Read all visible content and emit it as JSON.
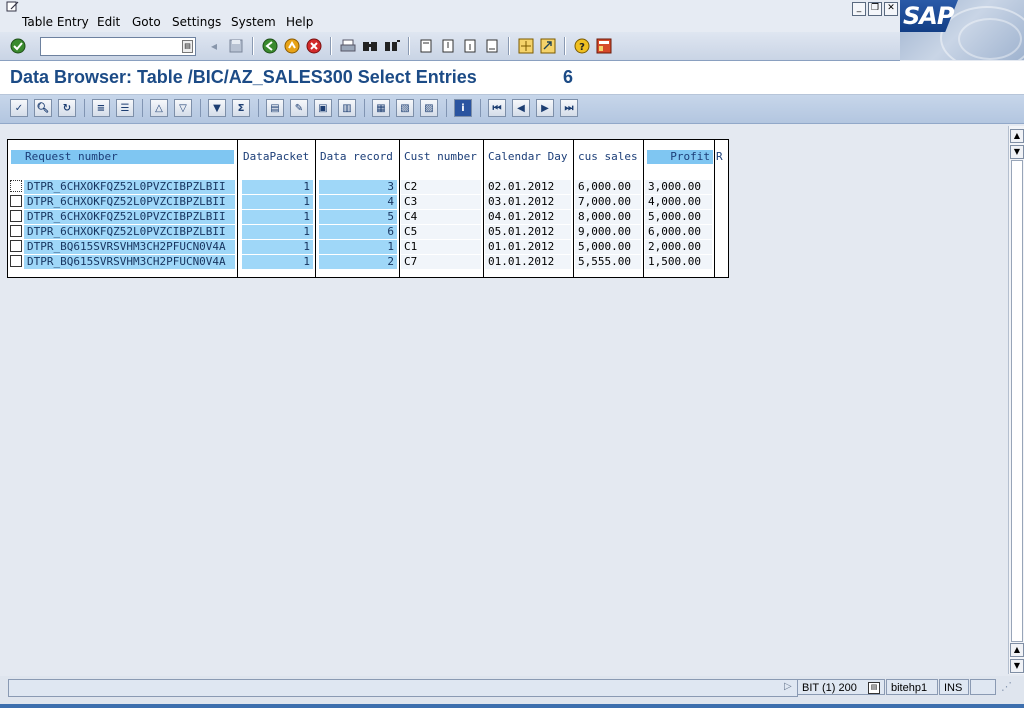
{
  "menu": {
    "items": [
      {
        "label": "Table Entry",
        "accel": "T"
      },
      {
        "label": "Edit",
        "accel": "E"
      },
      {
        "label": "Goto",
        "accel": "G"
      },
      {
        "label": "Settings",
        "accel": "S"
      },
      {
        "label": "System",
        "accel": "y"
      },
      {
        "label": "Help",
        "accel": "H"
      }
    ]
  },
  "brand": {
    "logo_text": "SAP"
  },
  "command_field": {
    "value": ""
  },
  "title": {
    "text": "Data Browser: Table /BIC/AZ_SALES300 Select Entries",
    "count": "6"
  },
  "grid": {
    "columns": [
      "Request number",
      "DataPacket",
      "Data record",
      "Cust number",
      "Calendar Day",
      "cus sales",
      "Profit",
      "R"
    ],
    "rows": [
      {
        "request": "DTPR_6CHXOKFQZ52L0PVZCIBPZLBII",
        "packet": "1",
        "record": "3",
        "cust": "C2",
        "day": "02.01.2012",
        "sales": "6,000.00",
        "profit": "3,000.00"
      },
      {
        "request": "DTPR_6CHXOKFQZ52L0PVZCIBPZLBII",
        "packet": "1",
        "record": "4",
        "cust": "C3",
        "day": "03.01.2012",
        "sales": "7,000.00",
        "profit": "4,000.00"
      },
      {
        "request": "DTPR_6CHXOKFQZ52L0PVZCIBPZLBII",
        "packet": "1",
        "record": "5",
        "cust": "C4",
        "day": "04.01.2012",
        "sales": "8,000.00",
        "profit": "5,000.00"
      },
      {
        "request": "DTPR_6CHXOKFQZ52L0PVZCIBPZLBII",
        "packet": "1",
        "record": "6",
        "cust": "C5",
        "day": "05.01.2012",
        "sales": "9,000.00",
        "profit": "6,000.00"
      },
      {
        "request": "DTPR_BQ615SVRSVHM3CH2PFUCN0V4A",
        "packet": "1",
        "record": "1",
        "cust": "C1",
        "day": "01.01.2012",
        "sales": "5,000.00",
        "profit": "2,000.00"
      },
      {
        "request": "DTPR_BQ615SVRSVHM3CH2PFUCN0V4A",
        "packet": "1",
        "record": "2",
        "cust": "C7",
        "day": "01.01.2012",
        "sales": "5,555.00",
        "profit": "1,500.00"
      }
    ]
  },
  "status": {
    "system": "BIT (1) 200",
    "server": "bitehp1",
    "mode": "INS"
  },
  "colors": {
    "title": "#1c4b86",
    "key_column": "#9fd7f8",
    "toolbar": "#c7d6ea"
  }
}
